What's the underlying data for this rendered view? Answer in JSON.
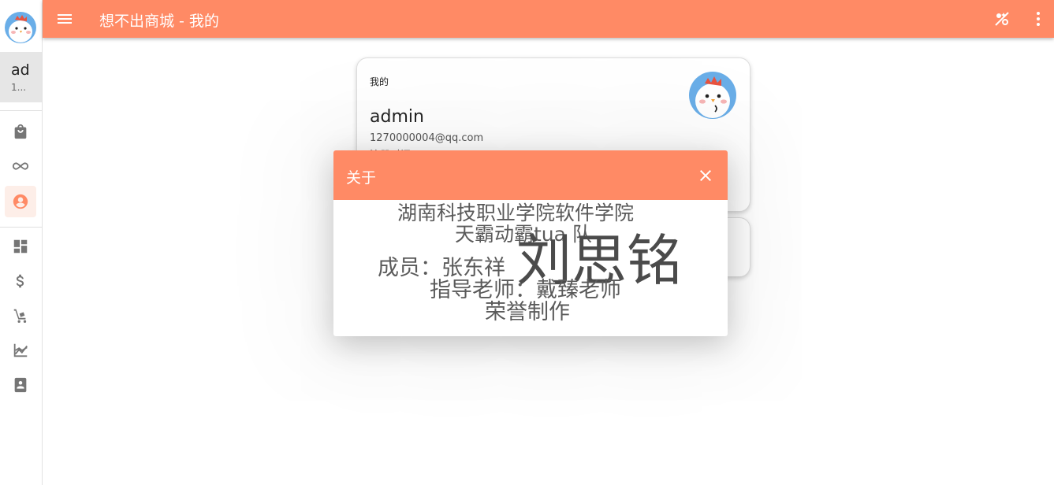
{
  "app": {
    "title": "想不出商城 - 我的"
  },
  "colors": {
    "accent": "#ff8a65"
  },
  "sidebar": {
    "user": {
      "name": "ad",
      "sub": "1..."
    },
    "items": [
      {
        "icon": "shopping-bag-icon"
      },
      {
        "icon": "infinity-icon"
      },
      {
        "icon": "account-circle-icon",
        "active": true
      },
      {
        "icon": "dashboard-icon"
      },
      {
        "icon": "dollar-icon"
      },
      {
        "icon": "cart-dolly-icon"
      },
      {
        "icon": "chart-line-icon"
      },
      {
        "icon": "contact-book-icon"
      }
    ]
  },
  "card": {
    "title": "我的",
    "name": "admin",
    "email": "1270000004@qq.com",
    "registered": "注册时间：2021-04-07 10:56:51"
  },
  "dialog": {
    "title": "关于",
    "lines": [
      "湖南科技职业学院软件学院",
      "天霸动霸tua 队",
      "成员：张东祥",
      "指导老师：戴臻老师",
      "荣誉制作"
    ],
    "big_name": "刘思铭"
  }
}
